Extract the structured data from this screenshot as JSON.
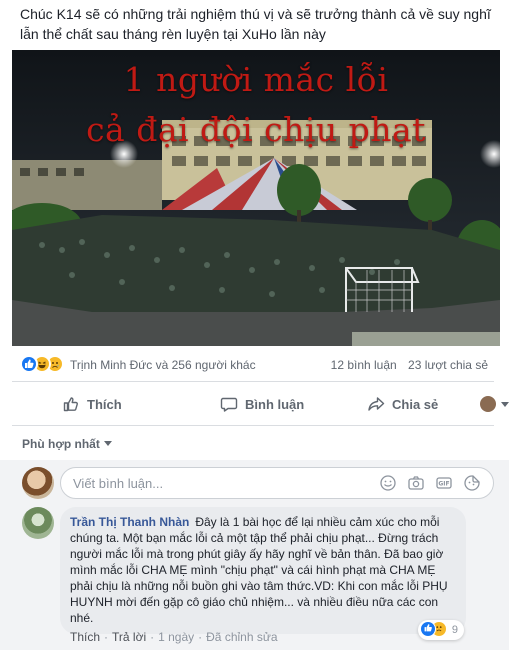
{
  "post": {
    "text": "Chúc K14 sẽ có những trải nghiệm thú vị và sẽ trưởng thành cả về suy nghĩ lẫn thể chất sau tháng rèn luyện tại XuHo lần này"
  },
  "photo": {
    "overlay_line1": "1 người mắc lỗi",
    "overlay_line2": "cả đại đội chịu phạt"
  },
  "reactions": {
    "icons": [
      "like-icon",
      "haha-icon",
      "sad-icon"
    ],
    "names": "Trịnh Minh Đức và 256 người khác",
    "comments_count": "12 bình luận",
    "shares_count": "23 lượt chia sẻ"
  },
  "actions": {
    "like": "Thích",
    "comment": "Bình luận",
    "share": "Chia sẻ"
  },
  "sort": {
    "label": "Phù hợp nhất"
  },
  "composer": {
    "placeholder": "Viết bình luận..."
  },
  "comment": {
    "author": "Trần Thị Thanh Nhàn",
    "text": "Đây là 1 bài học để lại nhiều cảm xúc cho mỗi chúng ta. Một bạn mắc lỗi cả một tập thể phải chịu phạt... Đừng trách người mắc lỗi mà trong phút giây ấy hãy nghĩ về bản thân. Đã bao giờ mình mắc lỗi CHA MẸ mình \"chịu phạt\" và cái hình phạt mà CHA MẸ phải chịu là những nỗi buồn ghi vào tâm thức.VD: Khi con mắc lỗi PHỤ HUYNH mời đến gặp cô giáo chủ nhiệm... và nhiều điều nữa các con nhé.",
    "reaction_count": "9",
    "like": "Thích",
    "reply": "Trả lời",
    "time": "1 ngày",
    "edited": "Đã chỉnh sửa"
  },
  "colors": {
    "brand_blue": "#385898",
    "like_blue": "#1877f2",
    "overlay_red": "#c01a14"
  }
}
